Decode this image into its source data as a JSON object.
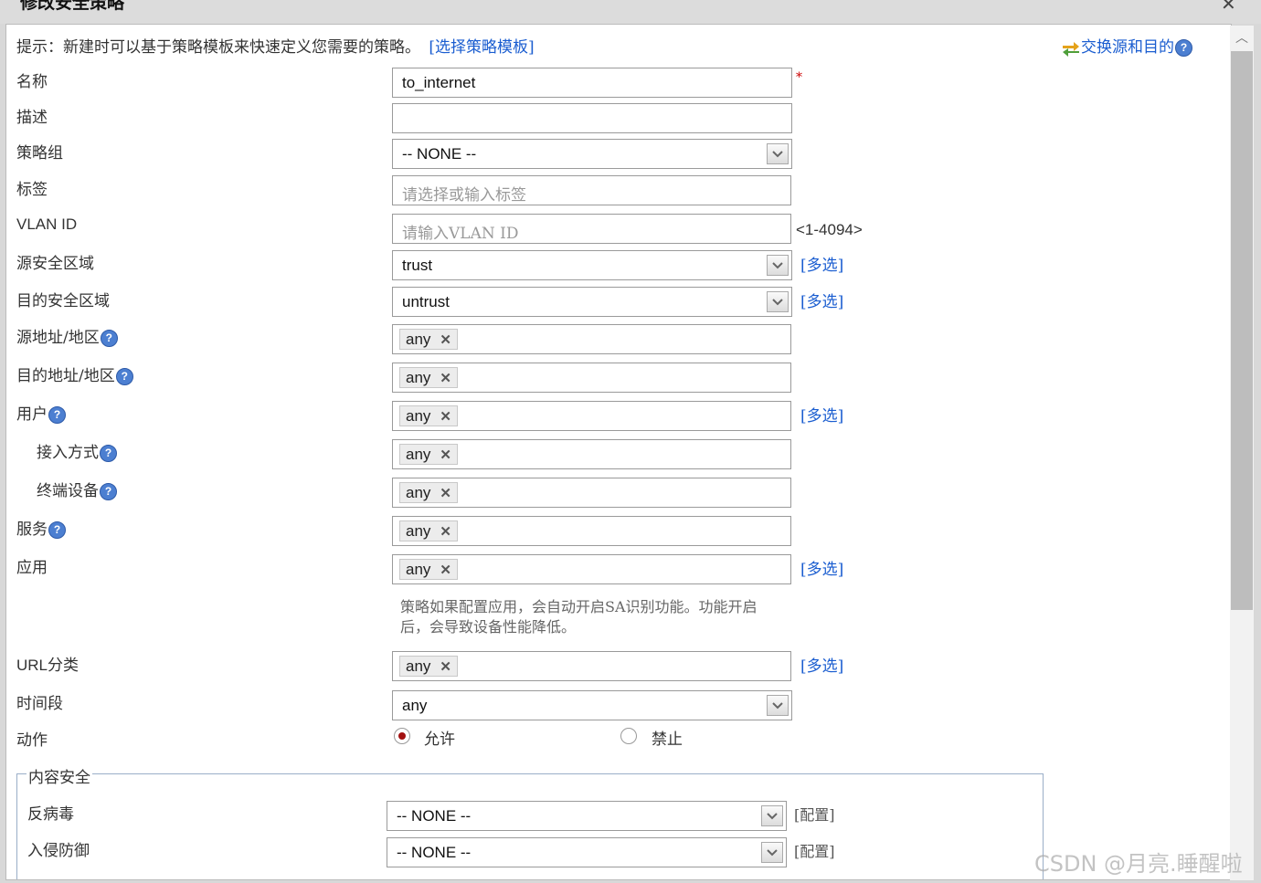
{
  "dialog": {
    "title": "修改安全策略",
    "close_icon": "close-icon"
  },
  "top": {
    "hint_prefix": "提示：新建时可以基于策略模板来快速定义您需要的策略。",
    "template_link": "[选择策略模板]",
    "swap_label": "交换源和目的"
  },
  "fields": {
    "name": {
      "label": "名称",
      "value": "to_internet",
      "required_mark": "*"
    },
    "desc": {
      "label": "描述",
      "value": ""
    },
    "group": {
      "label": "策略组",
      "value": "-- NONE --"
    },
    "tag": {
      "label": "标签",
      "placeholder": "请选择或输入标签"
    },
    "vlan": {
      "label": "VLAN ID",
      "placeholder": "请输入VLAN ID",
      "range": "<1-4094>"
    },
    "src_zone": {
      "label": "源安全区域",
      "value": "trust",
      "multi": "[多选]"
    },
    "dst_zone": {
      "label": "目的安全区域",
      "value": "untrust",
      "multi": "[多选]"
    },
    "src_addr": {
      "label": "源地址/地区",
      "tag": "any"
    },
    "dst_addr": {
      "label": "目的地址/地区",
      "tag": "any"
    },
    "user": {
      "label": "用户",
      "tag": "any",
      "multi": "[多选]"
    },
    "access": {
      "label": "接入方式",
      "tag": "any"
    },
    "terminal": {
      "label": "终端设备",
      "tag": "any"
    },
    "service": {
      "label": "服务",
      "tag": "any"
    },
    "app": {
      "label": "应用",
      "tag": "any",
      "multi": "[多选]",
      "note_line1": "策略如果配置应用，会自动开启SA识别功能。功能开启",
      "note_line2": "后，会导致设备性能降低。"
    },
    "url": {
      "label": "URL分类",
      "tag": "any",
      "multi": "[多选]"
    },
    "time": {
      "label": "时间段",
      "value": "any"
    },
    "action": {
      "label": "动作",
      "allow": "允许",
      "deny": "禁止",
      "selected": "允许"
    }
  },
  "content_security": {
    "legend": "内容安全",
    "antivirus": {
      "label": "反病毒",
      "value": "-- NONE --",
      "config": "[配置]"
    },
    "ips": {
      "label": "入侵防御",
      "value": "-- NONE --",
      "config": "[配置]"
    }
  },
  "help_mark": "?",
  "tag_remove": "✕",
  "watermark": "CSDN @月亮.睡醒啦",
  "colors": {
    "link": "#1a5dd0",
    "required": "#cc0000",
    "radio_on": "#a21010",
    "help": "#4c7fd1"
  }
}
